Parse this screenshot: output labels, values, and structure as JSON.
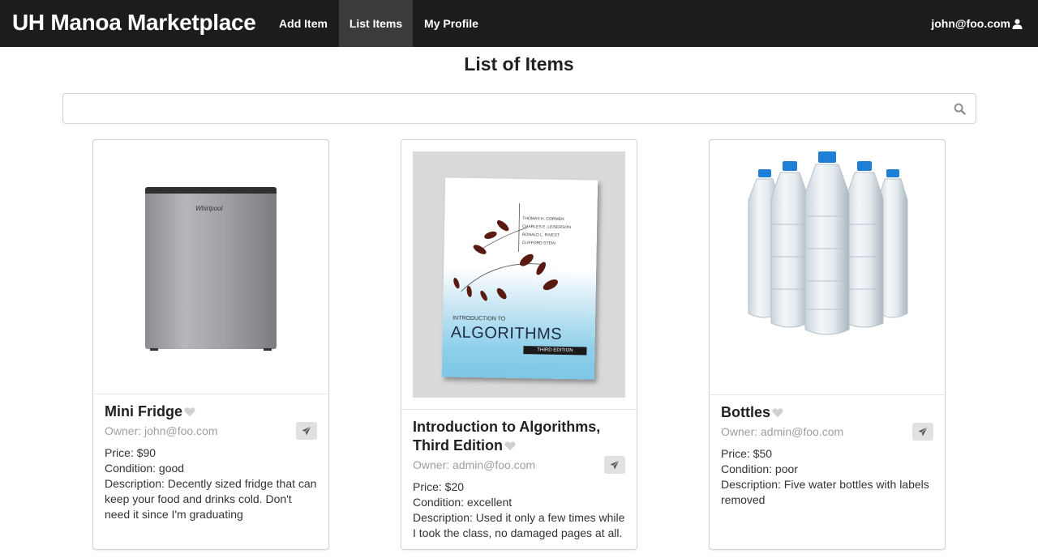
{
  "navbar": {
    "brand": "UH Manoa Marketplace",
    "items": [
      {
        "label": "Add Item"
      },
      {
        "label": "List Items",
        "active": true
      },
      {
        "label": "My Profile"
      }
    ],
    "user": "john@foo.com",
    "user_icon": "user-icon"
  },
  "page": {
    "title": "List of Items"
  },
  "search": {
    "value": "",
    "placeholder": "",
    "icon": "search-icon"
  },
  "items": [
    {
      "title": "Mini Fridge",
      "owner": "Owner: john@foo.com",
      "price": "Price: $90",
      "condition": "Condition: good",
      "description": "Description: Decently sized fridge that can keep your food and drinks cold. Don't need it since I'm graduating",
      "image": "mini-fridge-photo",
      "brand_text": "Whirlpool"
    },
    {
      "title": "Introduction to Algorithms, Third Edition",
      "owner": "Owner: admin@foo.com",
      "price": "Price: $20",
      "condition": "Condition: excellent",
      "description": "Description: Used it only a few times while I took the class, no damaged pages at all.",
      "image": "algorithms-book-photo",
      "cover": {
        "authors": [
          "THOMAS H. CORMEN",
          "CHARLES E. LEISERSON",
          "RONALD L. RIVEST",
          "CLIFFORD STEIN"
        ],
        "intro": "INTRODUCTION TO",
        "title": "ALGORITHMS",
        "edition": "THIRD EDITION"
      }
    },
    {
      "title": "Bottles",
      "owner": "Owner: admin@foo.com",
      "price": "Price: $50",
      "condition": "Condition: poor",
      "description": "Description: Five water bottles with labels removed",
      "image": "water-bottles-photo"
    }
  ],
  "colors": {
    "navbar_bg": "#1b1c1d",
    "nav_active_bg": "#3a3b3c",
    "owner_text": "#9e9e9e",
    "button_bg": "#e0e1e2",
    "bottle_cap": "#1e7fd6"
  }
}
